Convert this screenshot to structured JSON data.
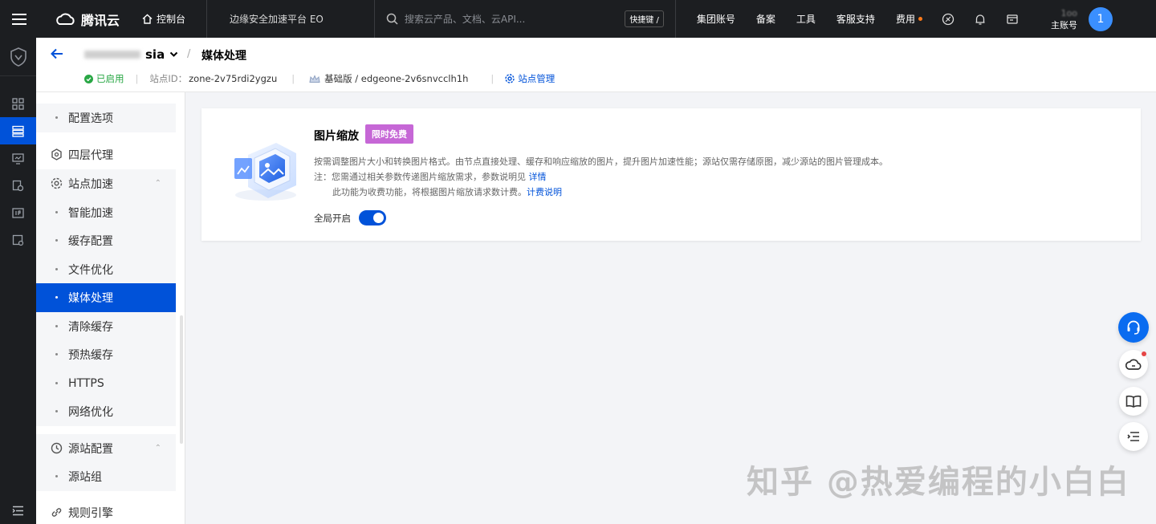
{
  "topbar": {
    "brand": "腾讯云",
    "console_label": "控制台",
    "product": "边缘安全加速平台 EO",
    "search_placeholder": "搜索云产品、文档、云API...",
    "shortcut": "快捷键 /",
    "links": [
      "集团账号",
      "备案",
      "工具",
      "客服支持",
      "费用"
    ],
    "account_masked": "1oo",
    "account_role": "主账号",
    "avatar": "1"
  },
  "header": {
    "site_suffix": "sia",
    "page_title": "媒体处理",
    "status": "已启用",
    "site_id_label": "站点ID：",
    "site_id": "zone-2v75rdi2ygzu",
    "plan": "基础版 / edgeone-2v6snvcclh1h",
    "site_manage": "站点管理"
  },
  "sidebar": {
    "items": [
      {
        "label": "配置选项",
        "type": "child"
      },
      {
        "label": "四层代理",
        "type": "group"
      },
      {
        "label": "站点加速",
        "type": "group"
      },
      {
        "label": "智能加速",
        "type": "child"
      },
      {
        "label": "缓存配置",
        "type": "child"
      },
      {
        "label": "文件优化",
        "type": "child"
      },
      {
        "label": "媒体处理",
        "type": "child",
        "active": true
      },
      {
        "label": "清除缓存",
        "type": "child"
      },
      {
        "label": "预热缓存",
        "type": "child"
      },
      {
        "label": "HTTPS",
        "type": "child"
      },
      {
        "label": "网络优化",
        "type": "child"
      },
      {
        "label": "源站配置",
        "type": "group"
      },
      {
        "label": "源站组",
        "type": "child"
      },
      {
        "label": "规则引擎",
        "type": "group"
      }
    ]
  },
  "card": {
    "title": "图片缩放",
    "badge": "限时免费",
    "desc1": "按需调整图片大小和转换图片格式。由节点直接处理、缓存和响应缩放的图片，提升图片加速性能；源站仅需存储原图，减少源站的图片管理成本。",
    "desc2": "注：您需通过相关参数传递图片缩放需求，参数说明见",
    "desc2_link": "详情",
    "desc3": "此功能为收费功能，将根据图片缩放请求数计费。",
    "desc3_link": "计费说明",
    "toggle_label": "全局开启",
    "toggle_on": true
  },
  "watermark": "知乎 @热爱编程的小白白",
  "colors": {
    "accent": "#0052d9",
    "topbar": "#1c1e21",
    "badge": "#c667d6",
    "ok": "#29a745"
  }
}
